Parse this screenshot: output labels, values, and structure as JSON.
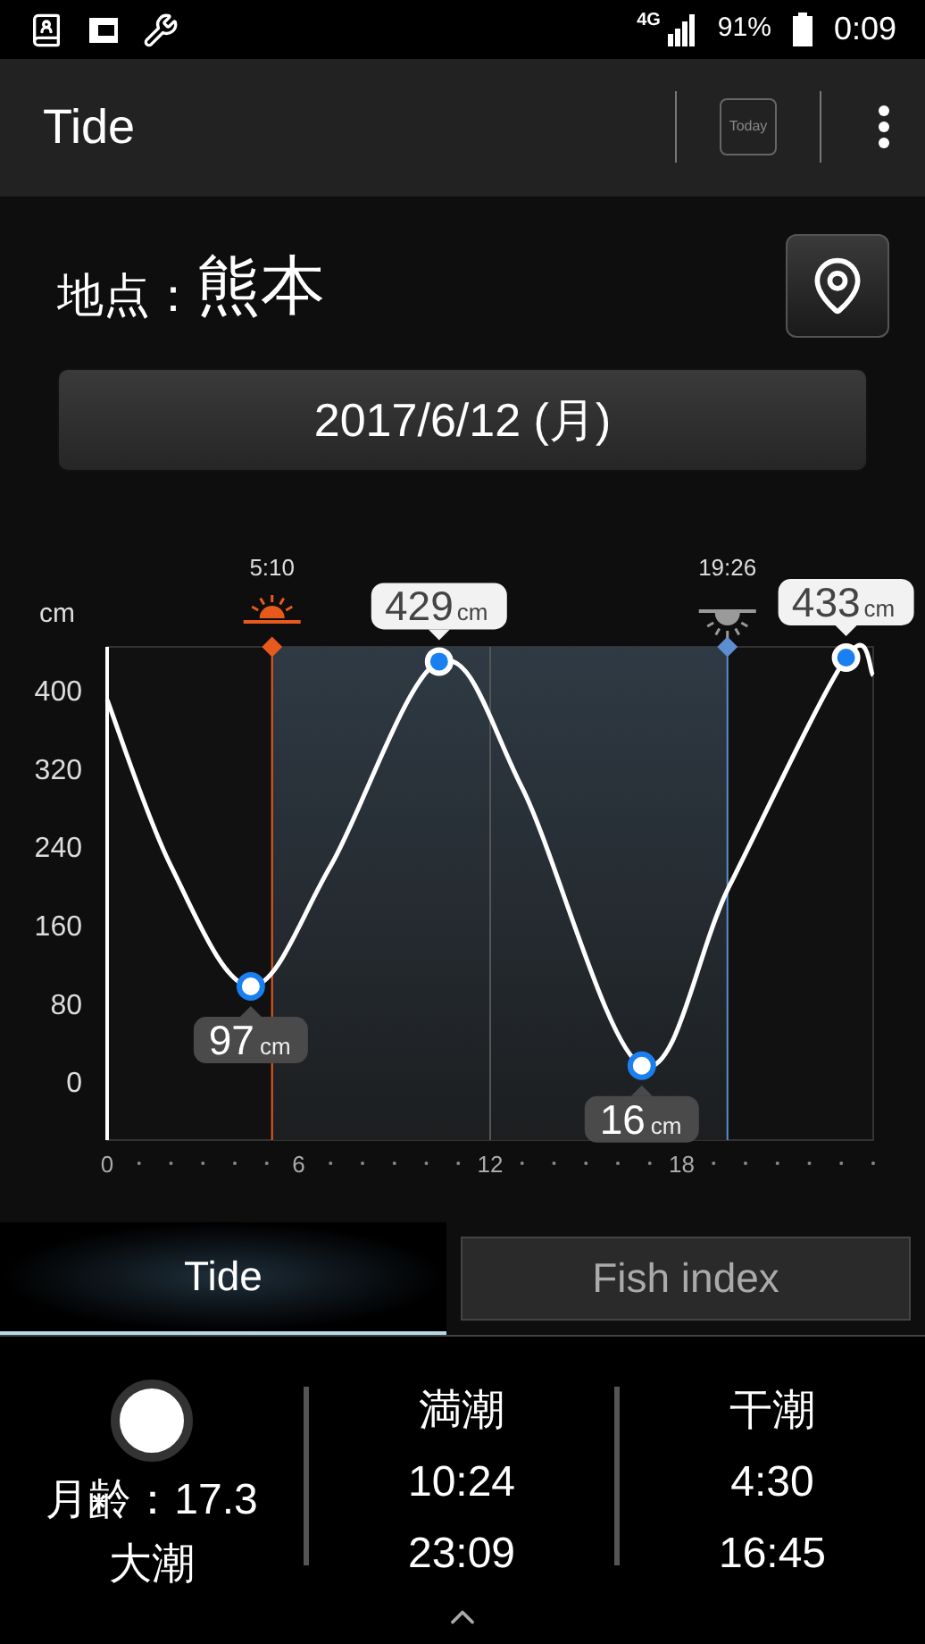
{
  "status_bar": {
    "network": "4G",
    "battery": "91%",
    "time": "0:09"
  },
  "toolbar": {
    "title": "Tide",
    "today_button": "Today"
  },
  "location": {
    "label": "地点：",
    "value": "熊本"
  },
  "date_button": "2017/6/12 (月)",
  "chart": {
    "chart_data": {
      "type": "line",
      "ylabel": "cm",
      "xlim": [
        0,
        24
      ],
      "ylim": [
        -60,
        444
      ],
      "xticks": [
        0,
        6,
        12,
        18
      ],
      "yticks": [
        0,
        80,
        160,
        240,
        320,
        400
      ],
      "x": [
        0,
        2,
        4.5,
        7,
        10.4,
        13,
        16.75,
        19.5,
        23.15,
        24
      ],
      "series": [
        {
          "color": "#ffffff",
          "values": [
            390,
            220,
            97,
            220,
            429,
            300,
            16,
            200,
            433,
            415
          ]
        }
      ],
      "ref_lines": [
        {
          "axis": "x",
          "value": 5.167,
          "label": "5:10",
          "color": "#e85a1c"
        },
        {
          "axis": "x",
          "value": 19.433,
          "label": "19:26",
          "color": "#5b8fd0"
        }
      ],
      "bands": [
        {
          "axis": "x",
          "from": 5.167,
          "to": 19.433
        }
      ]
    },
    "sun_events": [
      {
        "kind": "sunrise"
      },
      {
        "kind": "sunset"
      }
    ],
    "extremes": [
      {
        "value": "97",
        "unit": "cm"
      },
      {
        "value": "429",
        "unit": "cm"
      },
      {
        "value": "16",
        "unit": "cm"
      },
      {
        "value": "433",
        "unit": "cm"
      }
    ]
  },
  "tabs": [
    {
      "label": "Tide",
      "selected": true
    },
    {
      "label": "Fish index",
      "selected": false
    }
  ],
  "summary": {
    "moon_age": "月齢：17.3",
    "tide_type": "大潮",
    "columns": [
      {
        "heading": "満潮",
        "times": [
          "10:24",
          "23:09"
        ]
      },
      {
        "heading": "干潮",
        "times": [
          "4:30",
          "16:45"
        ]
      }
    ]
  }
}
